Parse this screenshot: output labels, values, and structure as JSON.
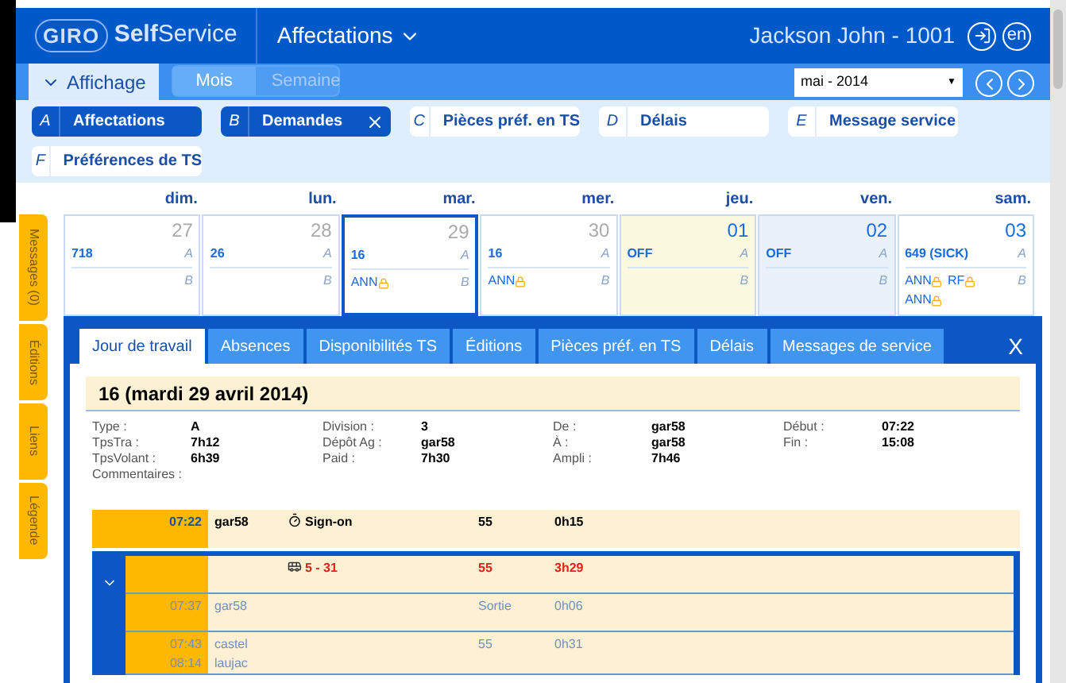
{
  "header": {
    "logo": "GIRO",
    "brand_bold": "Self",
    "brand": "Service",
    "module": "Affectations",
    "user": "Jackson John - 1001",
    "language": "en"
  },
  "toolbar": {
    "display_toggle": "Affichage",
    "views": [
      {
        "label": "Mois",
        "selected": true
      },
      {
        "label": "Semaine",
        "selected": false
      }
    ],
    "month_select": "mai - 2014",
    "month_select_arrow": "▼"
  },
  "filters": [
    {
      "letter": "A",
      "label": "Affectations",
      "selected": true,
      "closable": false
    },
    {
      "letter": "B",
      "label": "Demandes",
      "selected": true,
      "closable": true
    },
    {
      "letter": "C",
      "label": "Pièces préf. en TS",
      "selected": false,
      "closable": false
    },
    {
      "letter": "D",
      "label": "Délais",
      "selected": false,
      "closable": false
    },
    {
      "letter": "E",
      "label": "Message service",
      "selected": false,
      "closable": false
    },
    {
      "letter": "F",
      "label": "Préférences de TS",
      "selected": false,
      "closable": false
    }
  ],
  "side_tabs": [
    "Messages (0)",
    "Éditions",
    "Liens",
    "Légende"
  ],
  "calendar": {
    "weekdays": [
      "dim.",
      "lun.",
      "mar.",
      "mer.",
      "jeu.",
      "ven.",
      "sam."
    ],
    "days": [
      {
        "date": "27",
        "muted": true,
        "selected": false,
        "color": "#ffffff",
        "a_label": "A",
        "b_label": "B",
        "a": "718"
      },
      {
        "date": "28",
        "muted": true,
        "selected": false,
        "color": "#ffffff",
        "a_label": "A",
        "b_label": "B",
        "a": "26"
      },
      {
        "date": "29",
        "muted": true,
        "selected": true,
        "color": "#ffffff",
        "a_label": "A",
        "b_label": "B",
        "a": "16",
        "b": [
          {
            "text": "ANN",
            "locked": true
          }
        ]
      },
      {
        "date": "30",
        "muted": true,
        "selected": false,
        "color": "#ffffff",
        "a_label": "A",
        "b_label": "B",
        "a": "16",
        "b": [
          {
            "text": "ANN",
            "locked": true
          }
        ]
      },
      {
        "date": "01",
        "muted": false,
        "selected": false,
        "color": "#fbf9df",
        "a_label": "A",
        "b_label": "B",
        "a": "OFF"
      },
      {
        "date": "02",
        "muted": false,
        "selected": false,
        "color": "#e9f1fb",
        "a_label": "A",
        "b_label": "B",
        "a": "OFF"
      },
      {
        "date": "03",
        "muted": false,
        "selected": false,
        "color": "#ffffff",
        "a_label": "A",
        "b_label": "B",
        "a": "649 (SICK)",
        "b": [
          {
            "text": "ANN",
            "locked": true
          },
          {
            "text": "RF",
            "locked": true
          },
          {
            "text": "ANN",
            "locked": true
          }
        ]
      }
    ]
  },
  "panel": {
    "close": "X",
    "tabs": [
      {
        "label": "Jour de travail",
        "selected": true
      },
      {
        "label": "Absences",
        "selected": false
      },
      {
        "label": "Disponibilités TS",
        "selected": false
      },
      {
        "label": "Éditions",
        "selected": false
      },
      {
        "label": "Pièces préf. en TS",
        "selected": false
      },
      {
        "label": "Délais",
        "selected": false
      },
      {
        "label": "Messages de service",
        "selected": false
      }
    ],
    "title": "16 (mardi 29 avril 2014)",
    "details": [
      [
        {
          "label": "Type :",
          "value": "A"
        },
        {
          "label": "TpsTra :",
          "value": "7h12"
        },
        {
          "label": "TpsVolant :",
          "value": "6h39"
        }
      ],
      [
        {
          "label": "Division :",
          "value": "3"
        },
        {
          "label": "Dépôt Ag :",
          "value": "gar58"
        },
        {
          "label": "Paid :",
          "value": "7h30"
        }
      ],
      [
        {
          "label": "De :",
          "value": "gar58"
        },
        {
          "label": "À :",
          "value": "gar58"
        },
        {
          "label": "Ampli :",
          "value": "7h46"
        }
      ],
      [
        {
          "label": "Début :",
          "value": "07:22"
        },
        {
          "label": "Fin :",
          "value": "15:08"
        }
      ]
    ],
    "comments_label": "Commentaires :",
    "signon": {
      "time": "07:22",
      "place": "gar58",
      "activity": "Sign-on",
      "code": "55",
      "duration": "0h15"
    },
    "block": {
      "expanded": true,
      "title": "5 - 31",
      "code": "55",
      "duration": "3h29",
      "rows": [
        {
          "times": [
            "07:37"
          ],
          "places": [
            "gar58"
          ],
          "code": "Sortie",
          "duration": "0h06"
        },
        {
          "times": [
            "07:43",
            "08:14"
          ],
          "places": [
            "castel",
            "laujac"
          ],
          "code": "55",
          "duration": "0h31"
        }
      ]
    }
  }
}
